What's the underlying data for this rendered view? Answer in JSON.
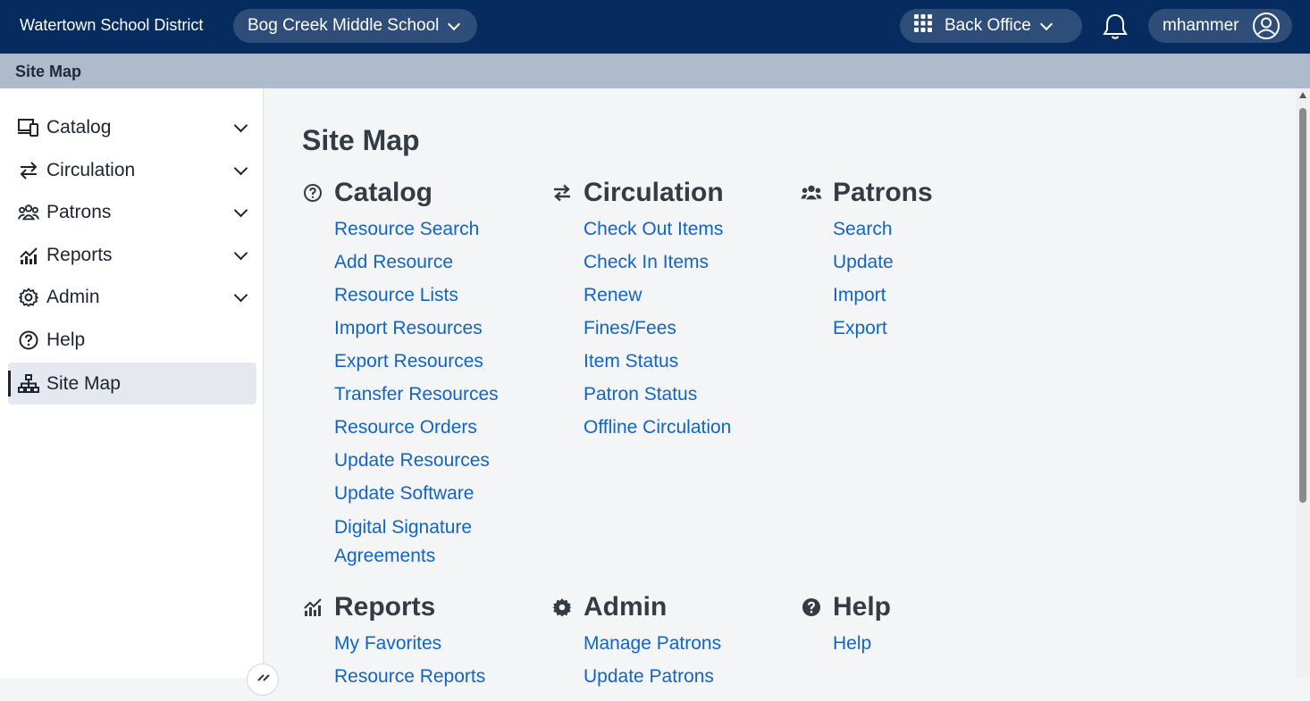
{
  "header": {
    "district": "Watertown School District",
    "school": "Bog Creek Middle School",
    "app_menu": "Back Office",
    "username": "mhammer"
  },
  "breadcrumb": "Site Map",
  "sidebar": {
    "items": [
      {
        "label": "Catalog",
        "icon": "catalog-icon",
        "expandable": true
      },
      {
        "label": "Circulation",
        "icon": "circulation-icon",
        "expandable": true
      },
      {
        "label": "Patrons",
        "icon": "patrons-icon",
        "expandable": true
      },
      {
        "label": "Reports",
        "icon": "reports-icon",
        "expandable": true
      },
      {
        "label": "Admin",
        "icon": "gear-icon",
        "expandable": true
      },
      {
        "label": "Help",
        "icon": "help-icon",
        "expandable": false
      },
      {
        "label": "Site Map",
        "icon": "sitemap-icon",
        "expandable": false,
        "active": true
      }
    ]
  },
  "main": {
    "title": "Site Map",
    "sections": [
      {
        "title": "Catalog",
        "icon": "help-circle-icon",
        "links": [
          "Resource Search",
          "Add Resource",
          "Resource Lists",
          "Import Resources",
          "Export Resources",
          "Transfer Resources",
          "Resource Orders",
          "Update Resources",
          "Update Software",
          "Digital Signature Agreements"
        ]
      },
      {
        "title": "Circulation",
        "icon": "circulation-icon",
        "links": [
          "Check Out Items",
          "Check In Items",
          "Renew",
          "Fines/Fees",
          "Item Status",
          "Patron Status",
          "Offline Circulation"
        ]
      },
      {
        "title": "Patrons",
        "icon": "patrons-icon",
        "links": [
          "Search",
          "Update",
          "Import",
          "Export"
        ]
      },
      {
        "title": "Reports",
        "icon": "reports-icon",
        "links": [
          "My Favorites",
          "Resource Reports"
        ]
      },
      {
        "title": "Admin",
        "icon": "gear-icon",
        "links": [
          "Manage Patrons",
          "Update Patrons"
        ]
      },
      {
        "title": "Help",
        "icon": "help-filled-icon",
        "links": [
          "Help"
        ]
      }
    ]
  },
  "colors": {
    "topbar": "#062b5e",
    "pill": "#2e4d78",
    "subbar": "#aebbcc",
    "link": "#1264c4"
  }
}
